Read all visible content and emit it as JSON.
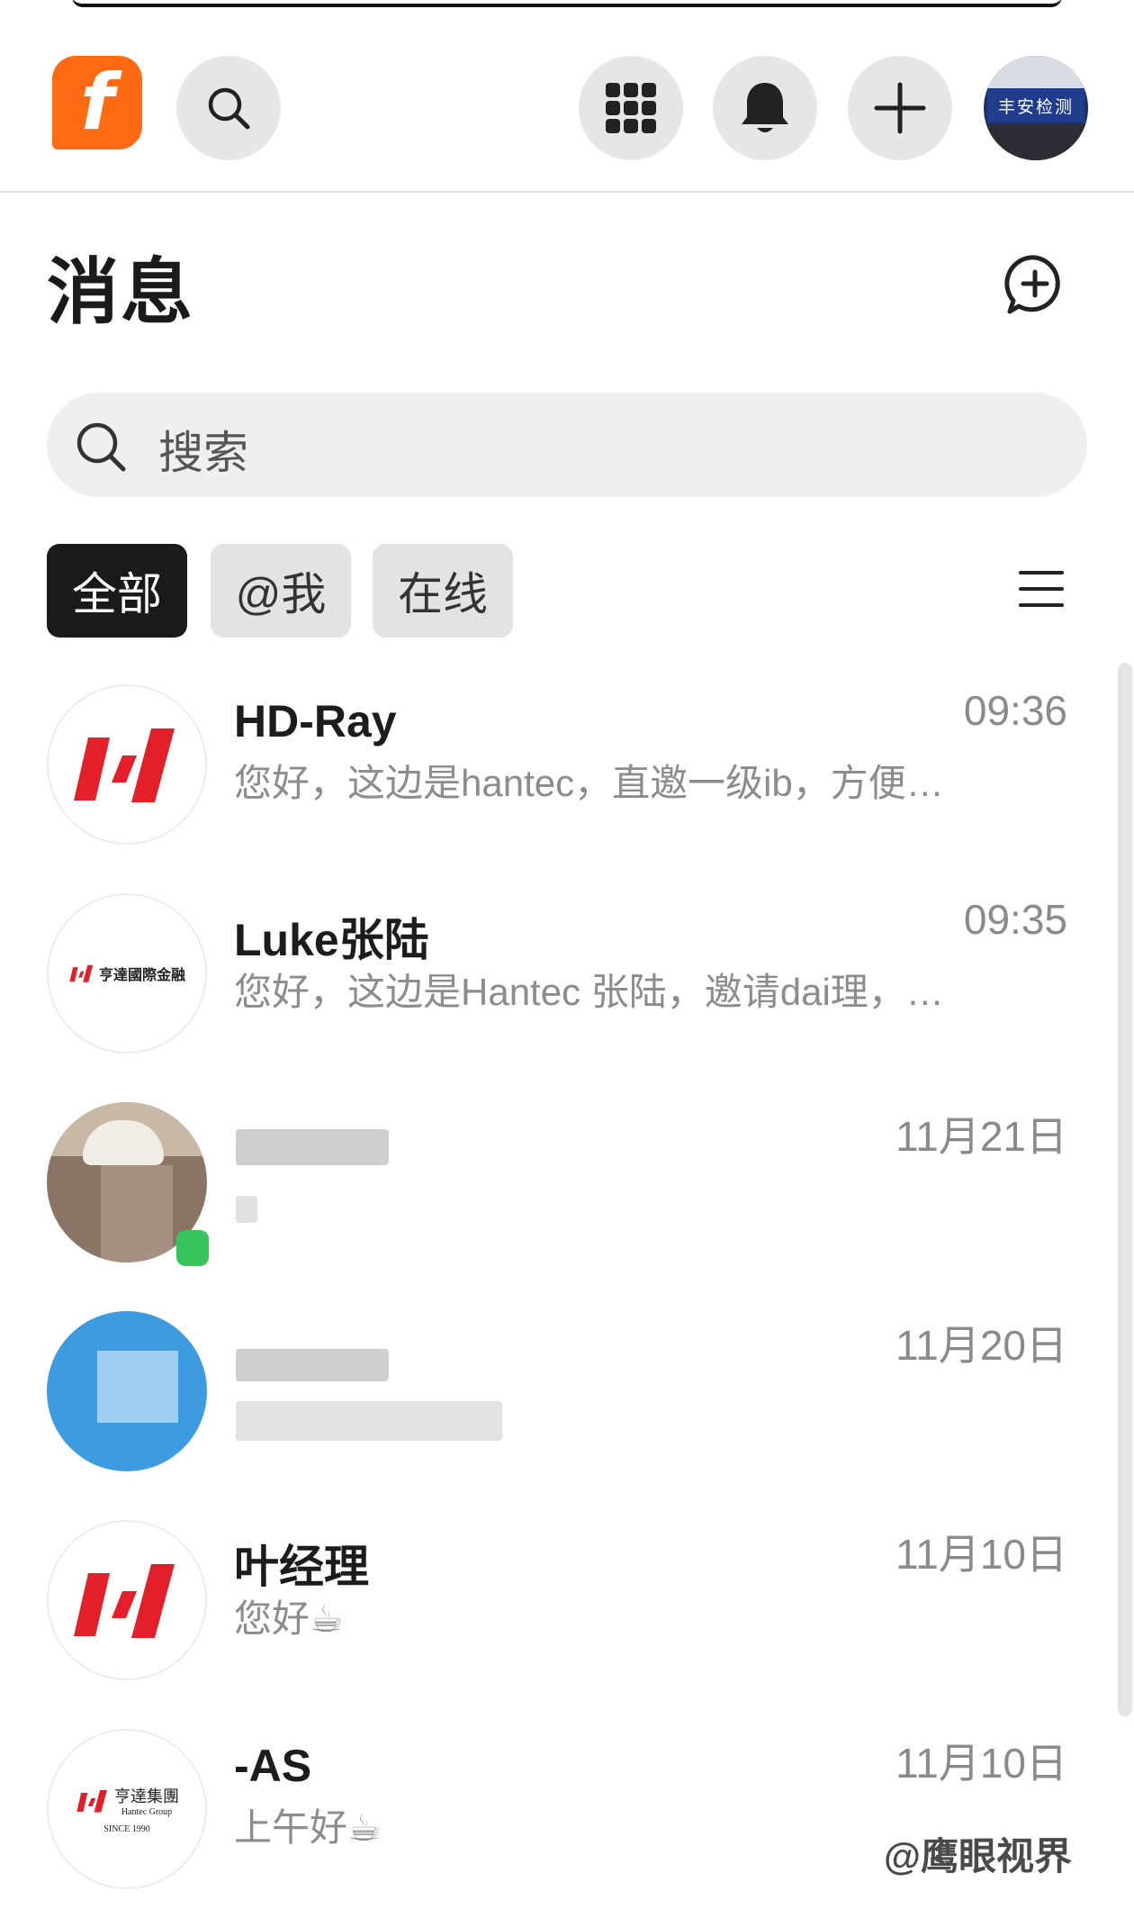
{
  "header": {
    "logo_letter": "f",
    "avatar_sign_text": "丰安检测",
    "icons": [
      "search-icon",
      "apps-grid-icon",
      "bell-icon",
      "plus-icon"
    ]
  },
  "page": {
    "title": "消息"
  },
  "search": {
    "placeholder": "搜索"
  },
  "tabs": [
    {
      "label": "全部",
      "active": true
    },
    {
      "label": "@我",
      "active": false
    },
    {
      "label": "在线",
      "active": false
    }
  ],
  "conversations": [
    {
      "name": "HD-Ray",
      "preview": "您好，这边是hantec，直邀一级ib，方便…",
      "time": "09:36",
      "avatar": "hantec-logo"
    },
    {
      "name": "Luke张陆",
      "preview": "您好，这边是Hantec 张陆，邀请dai理，…",
      "time": "09:35",
      "avatar": "hantec-intl-logo",
      "avatar_text": "亨達國際金融"
    },
    {
      "name": "",
      "preview": "",
      "time": "11月21日",
      "avatar": "blurred-photo"
    },
    {
      "name": "",
      "preview": "",
      "time": "11月20日",
      "avatar": "blurred-blue"
    },
    {
      "name": "叶经理",
      "preview": "您好☕",
      "time": "11月10日",
      "avatar": "hantec-logo"
    },
    {
      "name": "-AS",
      "preview": "上午好☕",
      "time": "11月10日",
      "avatar": "hantec-group-logo",
      "avatar_text": "亨達集團",
      "avatar_sub": "Hantec Group",
      "avatar_since": "SINCE 1990"
    }
  ],
  "watermark": "@鹰眼视界",
  "colors": {
    "brand_orange": "#ff6a13",
    "hantec_red": "#e3202a",
    "active_tab": "#1a1a1a",
    "online_green": "#37c45b"
  }
}
